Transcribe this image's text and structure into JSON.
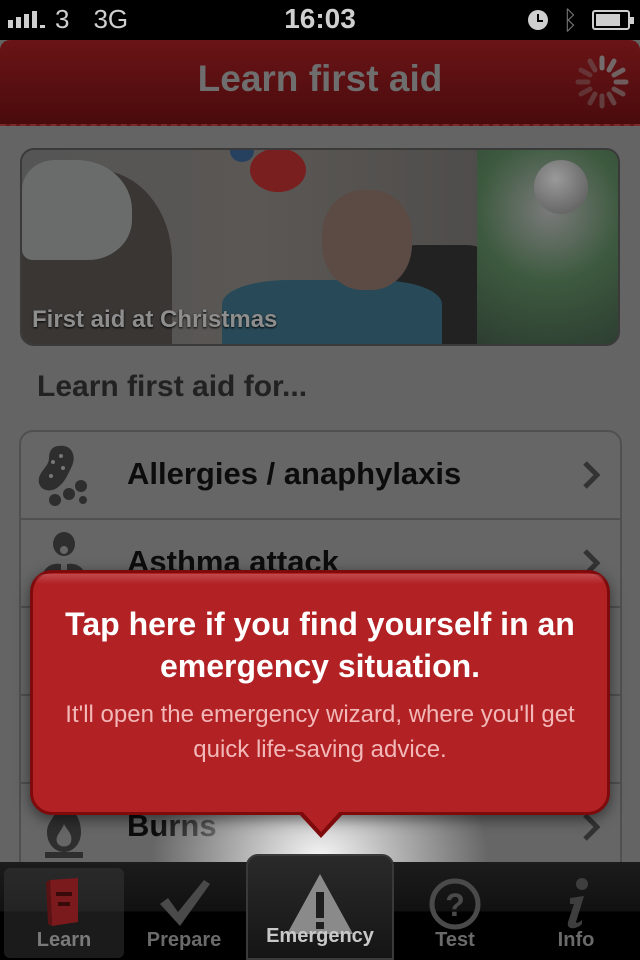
{
  "status_bar": {
    "carrier": "3",
    "network": "3G",
    "time": "16:03",
    "icons": [
      "signal-icon",
      "alarm-clock-icon",
      "bluetooth-icon",
      "battery-icon"
    ]
  },
  "nav": {
    "title": "Learn first aid",
    "activity_indicator": "spinner-icon"
  },
  "banner": {
    "caption": "First aid at Christmas"
  },
  "section": {
    "title": "Learn first aid for..."
  },
  "list": {
    "items": [
      {
        "label": "Allergies / anaphylaxis",
        "icon": "peanut-icon"
      },
      {
        "label": "Asthma attack",
        "icon": "lungs-icon"
      },
      {
        "label": "",
        "icon": "hidden-icon"
      },
      {
        "label": "",
        "icon": "hidden-icon"
      },
      {
        "label": "Burns",
        "icon": "flame-icon"
      }
    ]
  },
  "popover": {
    "headline": "Tap here if you find yourself in an emergency situation.",
    "subtext": "It'll open the emergency wizard, where you'll get quick life-saving advice."
  },
  "tabbar": {
    "tabs": [
      {
        "label": "Learn",
        "icon": "book-icon",
        "selected": true
      },
      {
        "label": "Prepare",
        "icon": "checkmark-icon"
      },
      {
        "label": "Emergency",
        "icon": "warning-triangle-icon"
      },
      {
        "label": "Test",
        "icon": "question-circle-icon"
      },
      {
        "label": "Info",
        "icon": "info-icon"
      }
    ]
  },
  "colors": {
    "brand_red": "#b22124",
    "brand_red_dark": "#7e0a0c",
    "nav_red": "#5a1012"
  }
}
